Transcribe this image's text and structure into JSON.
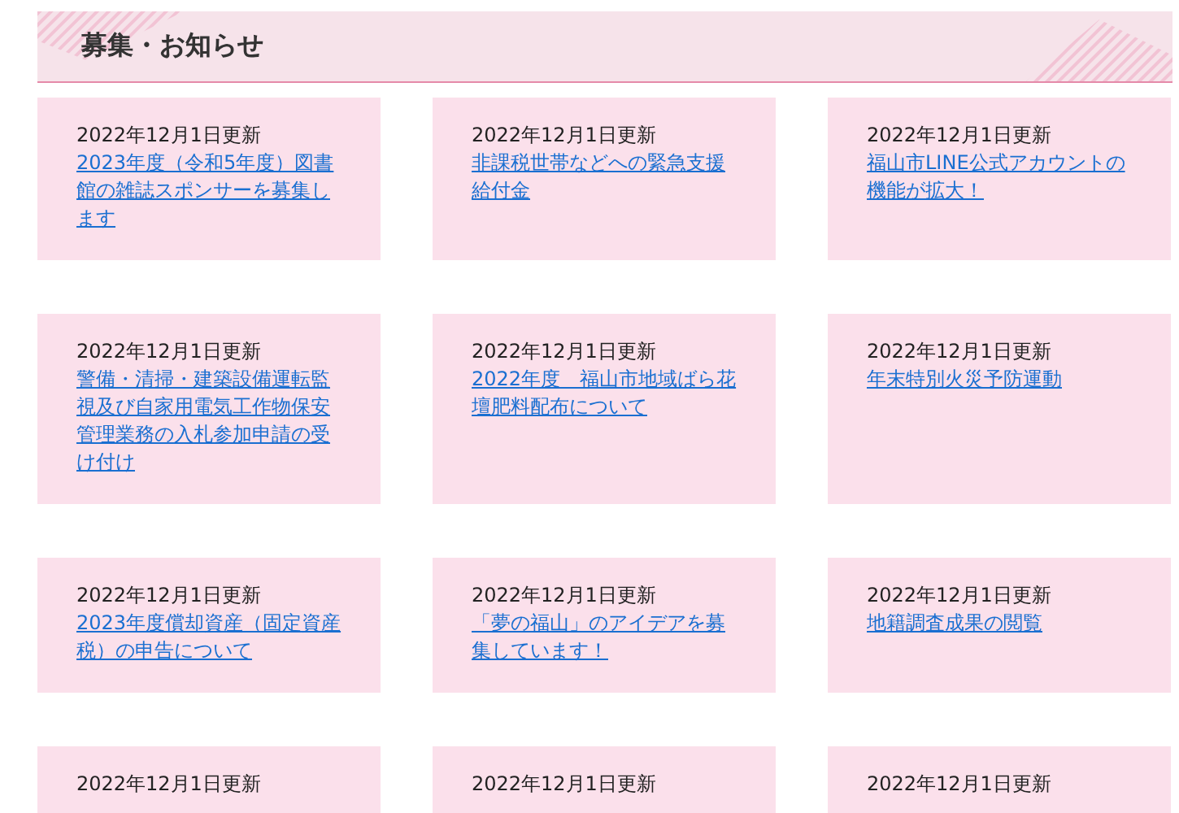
{
  "section_title": "募集・お知らせ",
  "items": [
    {
      "date": "2022年12月1日更新",
      "link": "2023年度（令和5年度）図書館の雑誌スポンサーを募集します"
    },
    {
      "date": "2022年12月1日更新",
      "link": "非課税世帯などへの緊急支援給付金"
    },
    {
      "date": "2022年12月1日更新",
      "link": "福山市LINE公式アカウントの機能が拡大！"
    },
    {
      "date": "2022年12月1日更新",
      "link": "警備・清掃・建築設備運転監視及び自家用電気工作物保安管理業務の入札参加申請の受け付け"
    },
    {
      "date": "2022年12月1日更新",
      "link": "2022年度　福山市地域ばら花壇肥料配布について"
    },
    {
      "date": "2022年12月1日更新",
      "link": "年末特別火災予防運動"
    },
    {
      "date": "2022年12月1日更新",
      "link": "2023年度償却資産（固定資産税）の申告について"
    },
    {
      "date": "2022年12月1日更新",
      "link": "「夢の福山」のアイデアを募集しています！"
    },
    {
      "date": "2022年12月1日更新",
      "link": "地籍調査成果の閲覧"
    },
    {
      "date": "2022年12月1日更新"
    },
    {
      "date": "2022年12月1日更新"
    },
    {
      "date": "2022年12月1日更新"
    }
  ]
}
